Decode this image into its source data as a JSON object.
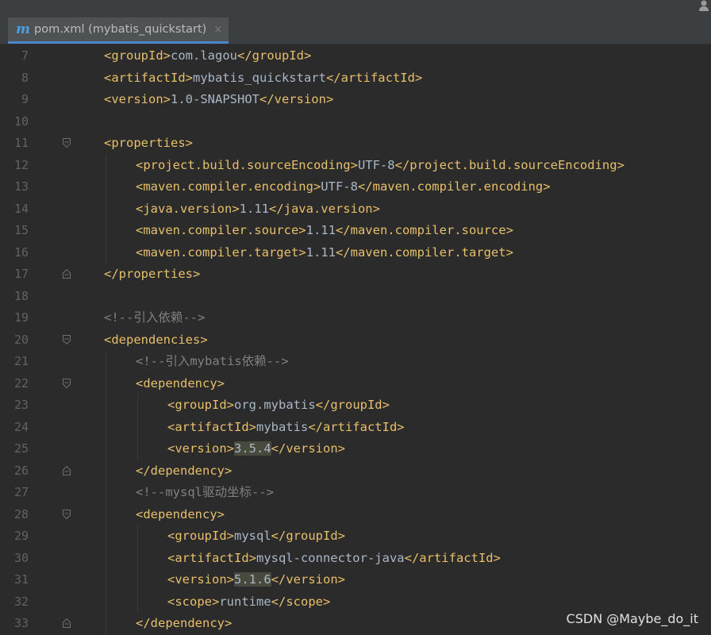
{
  "tab": {
    "icon_letter": "m",
    "label": "pom.xml (mybatis_quickstart)",
    "close": "×"
  },
  "watermark": "CSDN @Maybe_do_it",
  "colors": {
    "tag": "#e8bf6a",
    "text": "#a9b7c6",
    "comment": "#808080",
    "background": "#2b2b2b",
    "line_number": "#606366"
  },
  "lines": [
    {
      "n": "7",
      "indent": 1,
      "fold": "",
      "parts": [
        {
          "t": "<groupId>",
          "c": "tag"
        },
        {
          "t": "com.lagou",
          "c": "txt"
        },
        {
          "t": "</groupId>",
          "c": "tag"
        }
      ]
    },
    {
      "n": "8",
      "indent": 1,
      "fold": "",
      "parts": [
        {
          "t": "<artifactId>",
          "c": "tag"
        },
        {
          "t": "mybatis_quickstart",
          "c": "txt"
        },
        {
          "t": "</artifactId>",
          "c": "tag"
        }
      ]
    },
    {
      "n": "9",
      "indent": 1,
      "fold": "",
      "parts": [
        {
          "t": "<version>",
          "c": "tag"
        },
        {
          "t": "1.0-SNAPSHOT",
          "c": "txt"
        },
        {
          "t": "</version>",
          "c": "tag"
        }
      ]
    },
    {
      "n": "10",
      "indent": 1,
      "fold": "",
      "parts": []
    },
    {
      "n": "11",
      "indent": 1,
      "fold": "open",
      "parts": [
        {
          "t": "<properties>",
          "c": "tag"
        }
      ]
    },
    {
      "n": "12",
      "indent": 2,
      "fold": "",
      "parts": [
        {
          "t": "<project.build.sourceEncoding>",
          "c": "tag"
        },
        {
          "t": "UTF-8",
          "c": "txt"
        },
        {
          "t": "</project.build.sourceEncoding>",
          "c": "tag"
        }
      ]
    },
    {
      "n": "13",
      "indent": 2,
      "fold": "",
      "parts": [
        {
          "t": "<maven.compiler.encoding>",
          "c": "tag"
        },
        {
          "t": "UTF-8",
          "c": "txt"
        },
        {
          "t": "</maven.compiler.encoding>",
          "c": "tag"
        }
      ]
    },
    {
      "n": "14",
      "indent": 2,
      "fold": "",
      "parts": [
        {
          "t": "<java.version>",
          "c": "tag"
        },
        {
          "t": "1.11",
          "c": "txt"
        },
        {
          "t": "</java.version>",
          "c": "tag"
        }
      ]
    },
    {
      "n": "15",
      "indent": 2,
      "fold": "",
      "parts": [
        {
          "t": "<maven.compiler.source>",
          "c": "tag"
        },
        {
          "t": "1.11",
          "c": "txt"
        },
        {
          "t": "</maven.compiler.source>",
          "c": "tag"
        }
      ]
    },
    {
      "n": "16",
      "indent": 2,
      "fold": "",
      "parts": [
        {
          "t": "<maven.compiler.target>",
          "c": "tag"
        },
        {
          "t": "1.11",
          "c": "txt"
        },
        {
          "t": "</maven.compiler.target>",
          "c": "tag"
        }
      ]
    },
    {
      "n": "17",
      "indent": 1,
      "fold": "close",
      "parts": [
        {
          "t": "</properties>",
          "c": "tag"
        }
      ]
    },
    {
      "n": "18",
      "indent": 1,
      "fold": "",
      "parts": []
    },
    {
      "n": "19",
      "indent": 1,
      "fold": "",
      "parts": [
        {
          "t": "<!--引入依赖-->",
          "c": "cmt"
        }
      ]
    },
    {
      "n": "20",
      "indent": 1,
      "fold": "open",
      "parts": [
        {
          "t": "<dependencies>",
          "c": "tag"
        }
      ]
    },
    {
      "n": "21",
      "indent": 2,
      "fold": "",
      "parts": [
        {
          "t": "<!--引入mybatis依赖-->",
          "c": "cmt"
        }
      ]
    },
    {
      "n": "22",
      "indent": 2,
      "fold": "open",
      "parts": [
        {
          "t": "<dependency>",
          "c": "tag"
        }
      ]
    },
    {
      "n": "23",
      "indent": 3,
      "fold": "",
      "parts": [
        {
          "t": "<groupId>",
          "c": "tag"
        },
        {
          "t": "org.mybatis",
          "c": "txt"
        },
        {
          "t": "</groupId>",
          "c": "tag"
        }
      ]
    },
    {
      "n": "24",
      "indent": 3,
      "fold": "",
      "parts": [
        {
          "t": "<artifactId>",
          "c": "tag"
        },
        {
          "t": "mybatis",
          "c": "txt"
        },
        {
          "t": "</artifactId>",
          "c": "tag"
        }
      ]
    },
    {
      "n": "25",
      "indent": 3,
      "fold": "",
      "parts": [
        {
          "t": "<version>",
          "c": "tag"
        },
        {
          "t": "3.5.4",
          "c": "txt",
          "hl": true
        },
        {
          "t": "</version>",
          "c": "tag"
        }
      ]
    },
    {
      "n": "26",
      "indent": 2,
      "fold": "close",
      "parts": [
        {
          "t": "</dependency>",
          "c": "tag"
        }
      ]
    },
    {
      "n": "27",
      "indent": 2,
      "fold": "",
      "parts": [
        {
          "t": "<!--mysql驱动坐标-->",
          "c": "cmt"
        }
      ]
    },
    {
      "n": "28",
      "indent": 2,
      "fold": "open",
      "parts": [
        {
          "t": "<dependency>",
          "c": "tag"
        }
      ]
    },
    {
      "n": "29",
      "indent": 3,
      "fold": "",
      "parts": [
        {
          "t": "<groupId>",
          "c": "tag"
        },
        {
          "t": "mysql",
          "c": "txt"
        },
        {
          "t": "</groupId>",
          "c": "tag"
        }
      ]
    },
    {
      "n": "30",
      "indent": 3,
      "fold": "",
      "parts": [
        {
          "t": "<artifactId>",
          "c": "tag"
        },
        {
          "t": "mysql-connector-java",
          "c": "txt"
        },
        {
          "t": "</artifactId>",
          "c": "tag"
        }
      ]
    },
    {
      "n": "31",
      "indent": 3,
      "fold": "",
      "parts": [
        {
          "t": "<version>",
          "c": "tag"
        },
        {
          "t": "5.1.6",
          "c": "txt",
          "hl": true
        },
        {
          "t": "</version>",
          "c": "tag"
        }
      ]
    },
    {
      "n": "32",
      "indent": 3,
      "fold": "",
      "parts": [
        {
          "t": "<scope>",
          "c": "tag"
        },
        {
          "t": "runtime",
          "c": "txt"
        },
        {
          "t": "</scope>",
          "c": "tag"
        }
      ]
    },
    {
      "n": "33",
      "indent": 2,
      "fold": "close",
      "parts": [
        {
          "t": "</dependency>",
          "c": "tag"
        }
      ]
    }
  ]
}
